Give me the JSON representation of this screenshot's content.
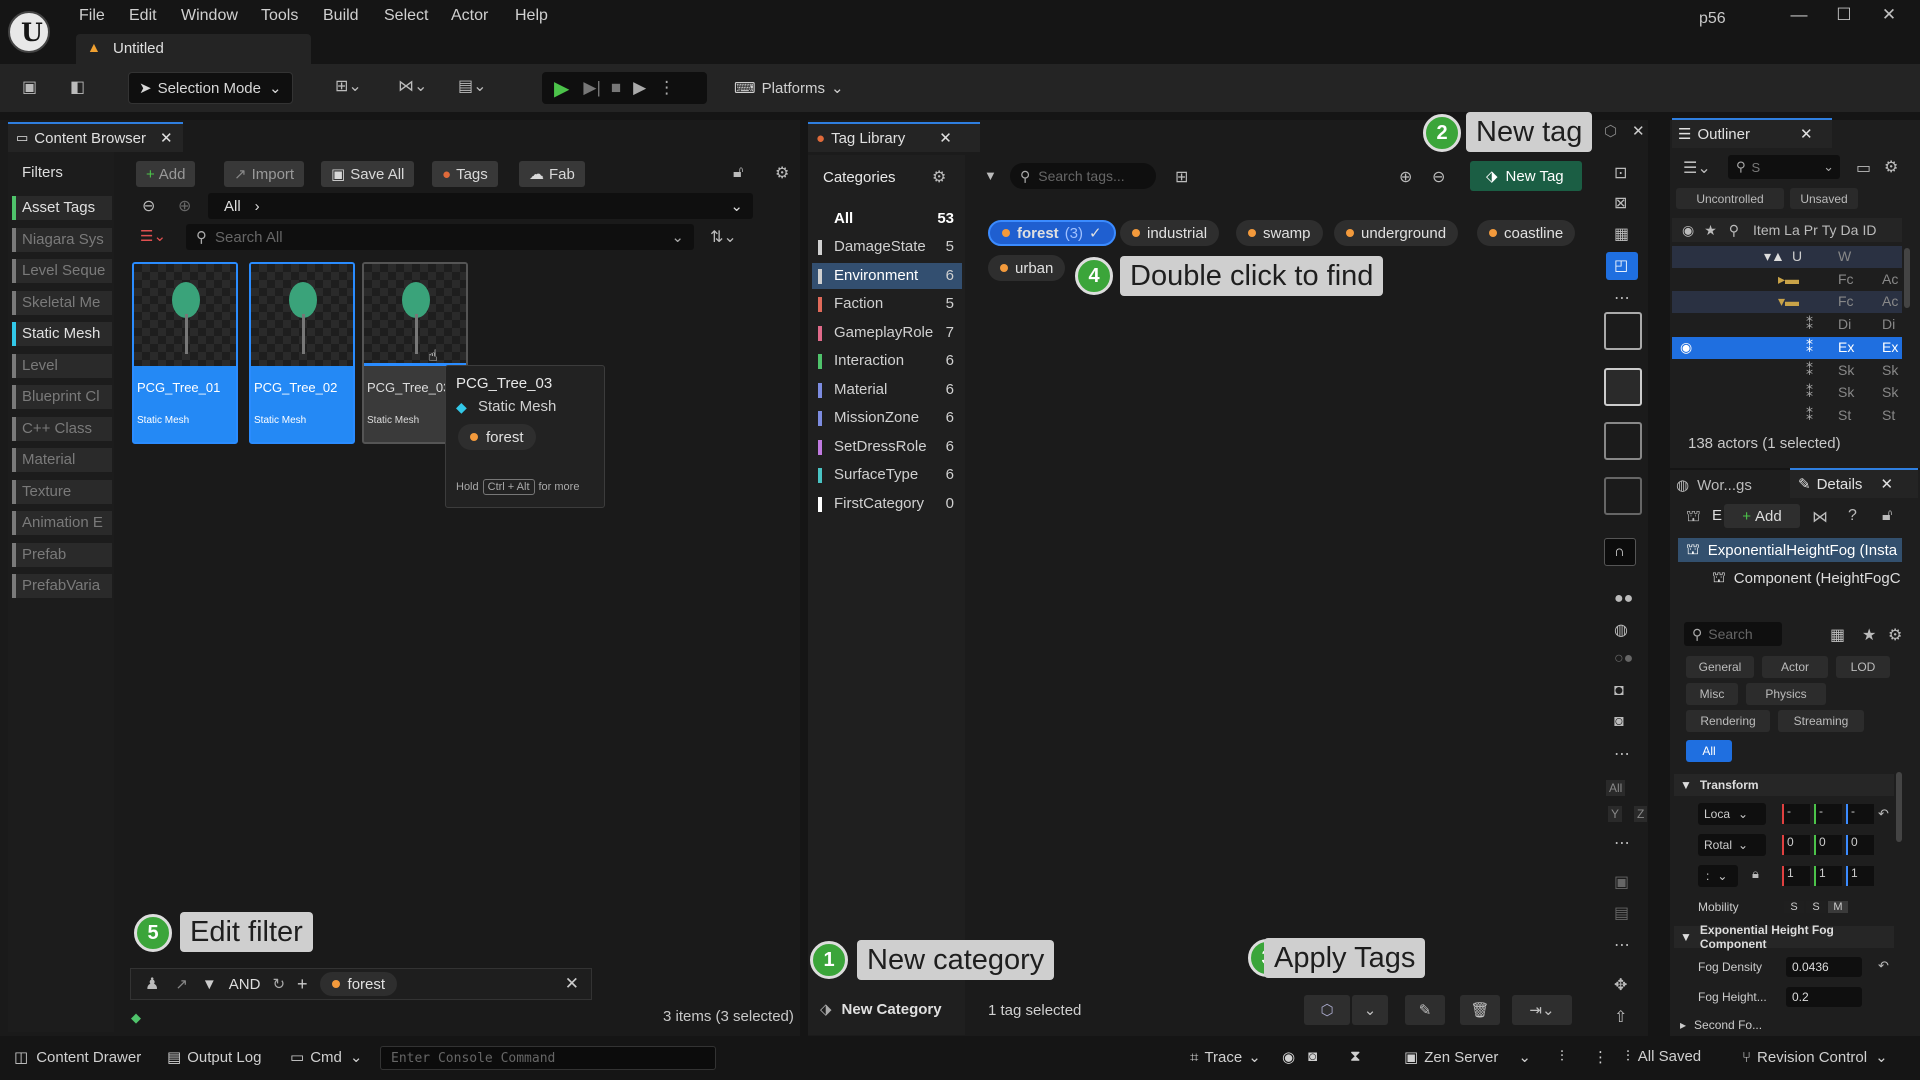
{
  "window": {
    "title_menu": [
      "File",
      "Edit",
      "Window",
      "Tools",
      "Build",
      "Select",
      "Actor",
      "Help"
    ],
    "doc_tab": "Untitled",
    "project": "p56"
  },
  "toolbar": {
    "selection_mode": "Selection Mode",
    "platforms": "Platforms"
  },
  "content_browser": {
    "tab": "Content Browser",
    "filters_title": "Filters",
    "filters": [
      "Asset Tags",
      "Niagara Sys",
      "Level Seque",
      "Skeletal Me",
      "Static Mesh",
      "Level",
      "Blueprint Cl",
      "C++ Class",
      "Material",
      "Texture",
      "Animation E",
      "Prefab",
      "PrefabVaria"
    ],
    "buttons": {
      "add": "Add",
      "import": "Import",
      "save_all": "Save All",
      "tags": "Tags",
      "fab": "Fab"
    },
    "path": "All",
    "search_placeholder": "Search All",
    "assets": [
      {
        "name": "PCG_Tree_01",
        "type": "Static Mesh"
      },
      {
        "name": "PCG_Tree_02",
        "type": "Static Mesh"
      },
      {
        "name": "PCG_Tree_03",
        "type": "Static Mesh"
      }
    ],
    "tooltip": {
      "name": "PCG_Tree_03",
      "type": "Static Mesh",
      "tag": "forest",
      "hint_prefix": "Hold",
      "hint_key": "Ctrl + Alt",
      "hint_suffix": "for more"
    },
    "filter_bar": {
      "op": "AND",
      "tag": "forest"
    },
    "status": "3 items (3 selected)"
  },
  "tag_library": {
    "tab": "Tag Library",
    "categories_title": "Categories",
    "categories": [
      {
        "name": "All",
        "count": "53",
        "color": ""
      },
      {
        "name": "DamageState",
        "count": "5",
        "color": "#d0d0d0"
      },
      {
        "name": "Environment",
        "count": "6",
        "color": "#d0d0d0"
      },
      {
        "name": "Faction",
        "count": "5",
        "color": "#e06a5a"
      },
      {
        "name": "GameplayRole",
        "count": "7",
        "color": "#e06a8a"
      },
      {
        "name": "Interaction",
        "count": "6",
        "color": "#4fc36b"
      },
      {
        "name": "Material",
        "count": "6",
        "color": "#7d8ce0"
      },
      {
        "name": "MissionZone",
        "count": "6",
        "color": "#7d8ce0"
      },
      {
        "name": "SetDressRole",
        "count": "6",
        "color": "#c07ae0"
      },
      {
        "name": "SurfaceType",
        "count": "6",
        "color": "#4ac4c4"
      },
      {
        "name": "FirstCategory",
        "count": "0",
        "color": "#ffffff"
      }
    ],
    "search_placeholder": "Search tags...",
    "new_tag": "New Tag",
    "tags": [
      {
        "name": "forest",
        "count": "(3)"
      },
      {
        "name": "industrial"
      },
      {
        "name": "swamp"
      },
      {
        "name": "underground"
      },
      {
        "name": "coastline"
      },
      {
        "name": "urban"
      }
    ],
    "new_category": "New Category",
    "selection_status": "1 tag selected"
  },
  "callouts": [
    {
      "num": "1",
      "text": "New category"
    },
    {
      "num": "2",
      "text": "New tag"
    },
    {
      "num": "3",
      "text": "Apply Tags"
    },
    {
      "num": "4",
      "text": "Double click to find"
    },
    {
      "num": "5",
      "text": "Edit filter"
    }
  ],
  "outliner": {
    "tab": "Outliner",
    "search_placeholder": "S",
    "uncontrolled": "Uncontrolled",
    "unsaved": "Unsaved",
    "columns": [
      "Item La",
      "Pr",
      "Ty",
      "Da",
      "ID"
    ],
    "rows": [
      {
        "label": "U",
        "type": "W"
      },
      {
        "label": "",
        "type": "Fc",
        "id": "Ac"
      },
      {
        "label": "",
        "type": "Fc",
        "id": "Ac"
      },
      {
        "label": "",
        "type": "Di",
        "id": "Di"
      },
      {
        "label": "",
        "type": "Ex",
        "id": "Ex"
      },
      {
        "label": "",
        "type": "Sk",
        "id": "Sk"
      },
      {
        "label": "",
        "type": "Sk",
        "id": "Sk"
      },
      {
        "label": "",
        "type": "St",
        "id": "St"
      }
    ],
    "status": "138 actors (1 selected)"
  },
  "details": {
    "tab_world": "Wor...gs",
    "tab_details": "Details",
    "add": "Add",
    "actor": "ExponentialHeightFog (Insta",
    "component": "Component (HeightFogC",
    "search_placeholder": "Search",
    "filter_buttons": [
      "General",
      "Actor",
      "LOD",
      "Misc",
      "Physics",
      "Rendering",
      "Streaming",
      "All"
    ],
    "transform_header": "Transform",
    "loc": "Loca",
    "rot": "Rotal",
    "scale": ":",
    "rot_vals": [
      "0",
      "0",
      "0"
    ],
    "scale_vals": [
      "1",
      "1",
      "1"
    ],
    "mobility": "Mobility",
    "mobility_opts": [
      "S",
      "S",
      "M"
    ],
    "component_header": "Exponential Height Fog Component",
    "fog_density_label": "Fog Density",
    "fog_density": "0.0436",
    "fog_height_label": "Fog Height...",
    "fog_height": "0.2",
    "second_fog": "Second Fo..."
  },
  "statusbar": {
    "content_drawer": "Content Drawer",
    "output_log": "Output Log",
    "cmd": "Cmd",
    "console_placeholder": "Enter Console Command",
    "trace": "Trace",
    "zen": "Zen Server",
    "all_saved": "All Saved",
    "revision": "Revision Control"
  }
}
